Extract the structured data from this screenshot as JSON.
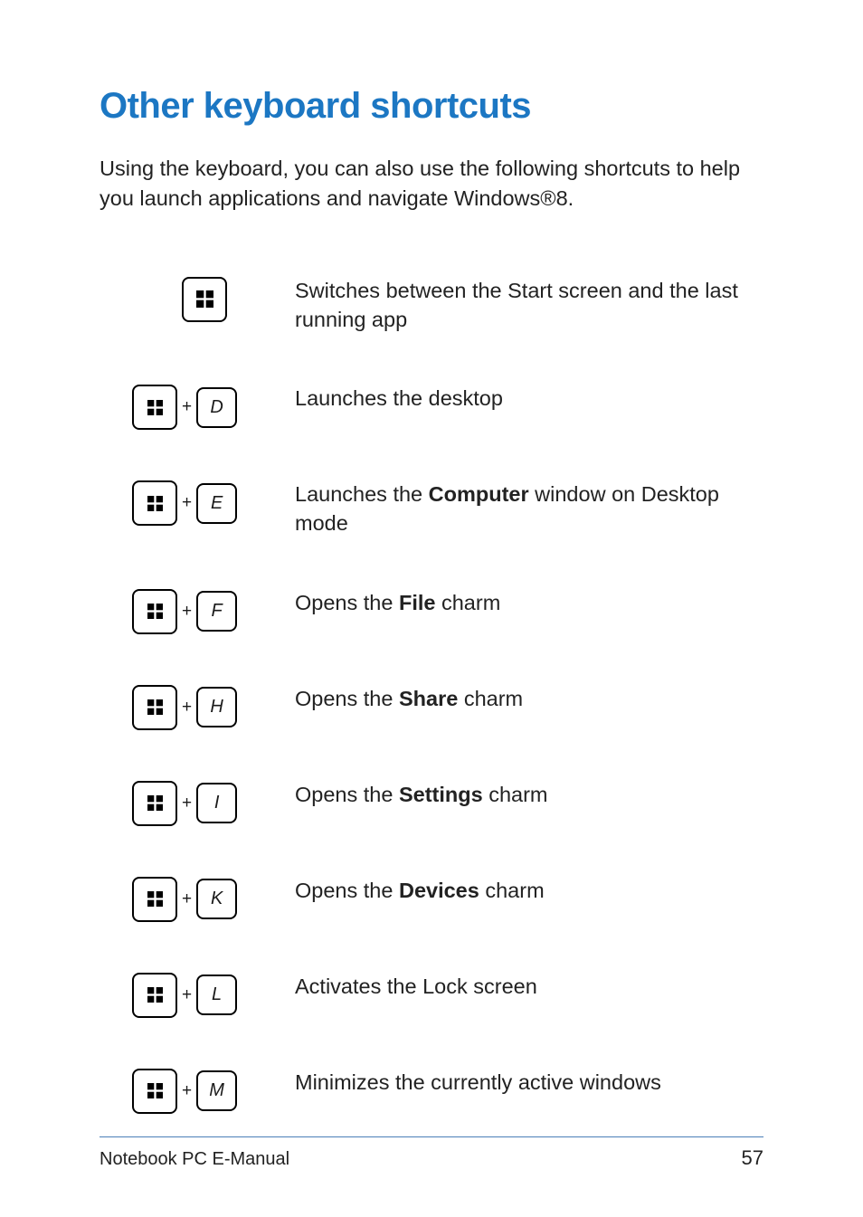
{
  "heading": "Other keyboard shortcuts",
  "intro": "Using the keyboard, you can also use the following shortcuts to help you launch applications and navigate Windows®8.",
  "shortcuts": [
    {
      "combo": [
        "WIN"
      ],
      "desc_pre": "Switches between the Start screen and the last running app",
      "bold": "",
      "desc_post": ""
    },
    {
      "combo": [
        "WIN",
        "D"
      ],
      "desc_pre": "Launches the desktop",
      "bold": "",
      "desc_post": ""
    },
    {
      "combo": [
        "WIN",
        "E"
      ],
      "desc_pre": "Launches the ",
      "bold": "Computer",
      "desc_post": " window on Desktop mode"
    },
    {
      "combo": [
        "WIN",
        "F"
      ],
      "desc_pre": "Opens the ",
      "bold": "File",
      "desc_post": " charm"
    },
    {
      "combo": [
        "WIN",
        "H"
      ],
      "desc_pre": "Opens the ",
      "bold": "Share",
      "desc_post": " charm"
    },
    {
      "combo": [
        "WIN",
        "I"
      ],
      "desc_pre": "Opens the ",
      "bold": "Settings",
      "desc_post": " charm"
    },
    {
      "combo": [
        "WIN",
        "K"
      ],
      "desc_pre": "Opens the ",
      "bold": "Devices",
      "desc_post": " charm"
    },
    {
      "combo": [
        "WIN",
        "L"
      ],
      "desc_pre": "Activates the Lock screen",
      "bold": "",
      "desc_post": ""
    },
    {
      "combo": [
        "WIN",
        "M"
      ],
      "desc_pre": "Minimizes the currently active windows",
      "bold": "",
      "desc_post": ""
    }
  ],
  "plus_glyph": "+",
  "footer": {
    "title": "Notebook PC E-Manual",
    "page": "57"
  }
}
